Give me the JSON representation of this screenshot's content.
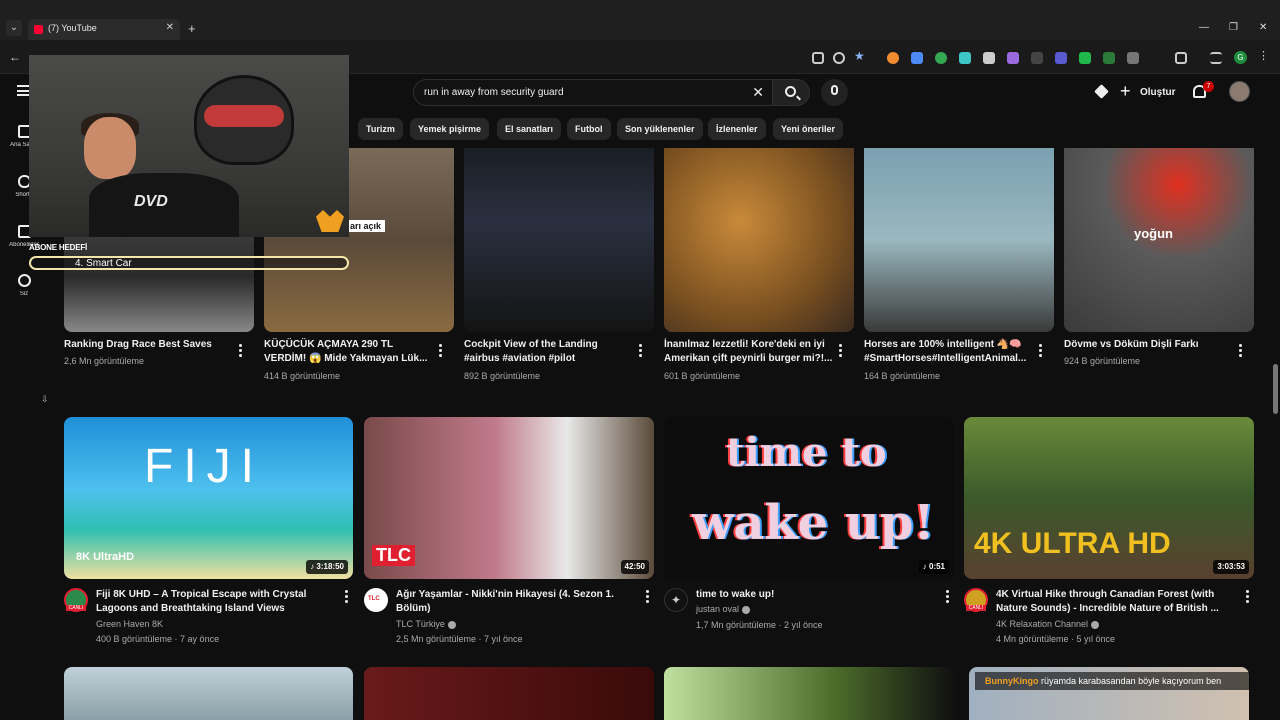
{
  "browser": {
    "tab_title": "(7) YouTube",
    "tab_close": "✕",
    "new_tab": "+",
    "min": "—",
    "max": "❐",
    "close": "✕",
    "back": "←",
    "profile_initial": "G"
  },
  "header": {
    "search_value": "run in away from security guard",
    "clear": "✕",
    "create_label": "Oluştur",
    "create_plus": "+",
    "notification_count": "7"
  },
  "chips": [
    "Turizm",
    "Yemek pişirme",
    "El sanatları",
    "Futbol",
    "Son yüklenenler",
    "İzlenenler",
    "Yeni öneriler"
  ],
  "nav": {
    "home": "Ana Sayfa",
    "shorts": "Shorts",
    "subscriptions": "Abonelikler",
    "you": "Siz"
  },
  "overlay": {
    "goal_label": "ABONE HEDEFİ",
    "goal_text": "4. Smart Car",
    "dvd": "DVD",
    "ticker_user": "BunnyKingo",
    "ticker_text": "rüyamda karabasandan böyle kaçıyorum ben"
  },
  "row1": [
    {
      "title": "Ranking Drag Race Best Saves",
      "meta": "2,6 Mn görüntüleme"
    },
    {
      "title": "KÜÇÜCÜK AÇMAYA 290 TL VERDİM! 😱 Mide Yakmayan Lük...",
      "meta": "414 B görüntüleme",
      "overlay": "arı açık"
    },
    {
      "title": "Cockpit View of the Landing #airbus #aviation #pilot",
      "meta": "892 B görüntüleme"
    },
    {
      "title": "İnanılmaz lezzetli! Kore'deki en iyi Amerikan çift peynirli burger mi?!...",
      "meta": "601 B görüntüleme"
    },
    {
      "title": "Horses are 100% intelligent 🐴🧠 #SmartHorses#IntelligentAnimal...",
      "meta": "164 B görüntüleme"
    },
    {
      "title": "Dövme vs Döküm Dişli Farkı",
      "meta": "924 B görüntüleme",
      "overlay": "yoğun"
    }
  ],
  "row2": [
    {
      "title": "Fiji 8K UHD – A Tropical Escape with Crystal Lagoons and Breathtaking Island Views",
      "channel": "Green Haven 8K",
      "meta": "400 B görüntüleme · 7 ay önce",
      "duration": "♪ 3:18:50",
      "avatar_text": "CANLI",
      "thumb_text": "FIJI",
      "badge": "8K UltraHD"
    },
    {
      "title": "Ağır Yaşamlar - Nikki'nin Hikayesi (4. Sezon 1. Bölüm)",
      "channel": "TLC Türkiye",
      "meta": "2,5 Mn görüntüleme · 7 yıl önce",
      "duration": "42:50",
      "avatar_text": "TLC",
      "badge": "TLC"
    },
    {
      "title": "time to wake up!",
      "channel": "justan oval",
      "meta": "1,7 Mn görüntüleme · 2 yıl önce",
      "duration": "♪ 0:51",
      "thumb_line1": "time to",
      "thumb_line2": "wake up!"
    },
    {
      "title": "4K Virtual Hike through Canadian Forest (with Nature Sounds) - Incredible Nature of British ...",
      "channel": "4K Relaxation Channel",
      "meta": "4 Mn görüntüleme · 5 yıl önce",
      "duration": "3:03:53",
      "avatar_text": "CANLI",
      "badge": "4K ULTRA HD"
    }
  ],
  "colors": {
    "accent": "#ff0033",
    "bg": "#0f0f0f",
    "chip": "#272727"
  }
}
